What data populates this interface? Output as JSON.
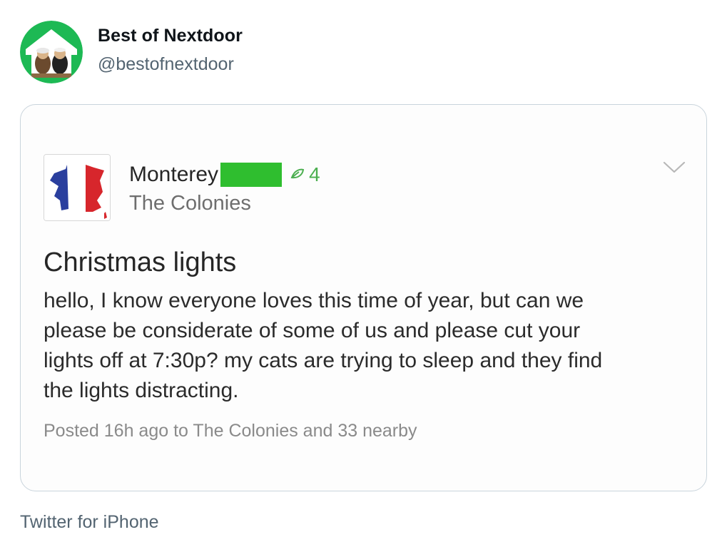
{
  "tweet": {
    "author_name": "Best of Nextdoor",
    "author_handle": "@bestofnextdoor",
    "avatar_icon": "nextdoor-house-logo-avatar",
    "source": "Twitter for iPhone"
  },
  "post": {
    "poster_name": "Monterey",
    "poster_name_redacted": true,
    "leaf_icon": "leaf-icon",
    "leaf_count": "4",
    "neighborhood": "The Colonies",
    "avatar_icon": "france-flag-map-avatar",
    "title": "Christmas lights",
    "body_lines": [
      "hello, I know everyone loves this time of year, but can we",
      "please be considerate of some of us and please cut your",
      "lights off at 7:30p? my cats are trying to sleep and they find",
      "the lights distracting."
    ],
    "meta": "Posted 16h ago to The Colonies and 33 nearby",
    "menu_icon": "chevron-down-icon"
  },
  "colors": {
    "nextdoor_green": "#1db954",
    "redaction_green": "#2fbe2f",
    "leaf_green": "#4caf50",
    "handle_gray": "#536471",
    "card_border": "#c9d4dc"
  }
}
